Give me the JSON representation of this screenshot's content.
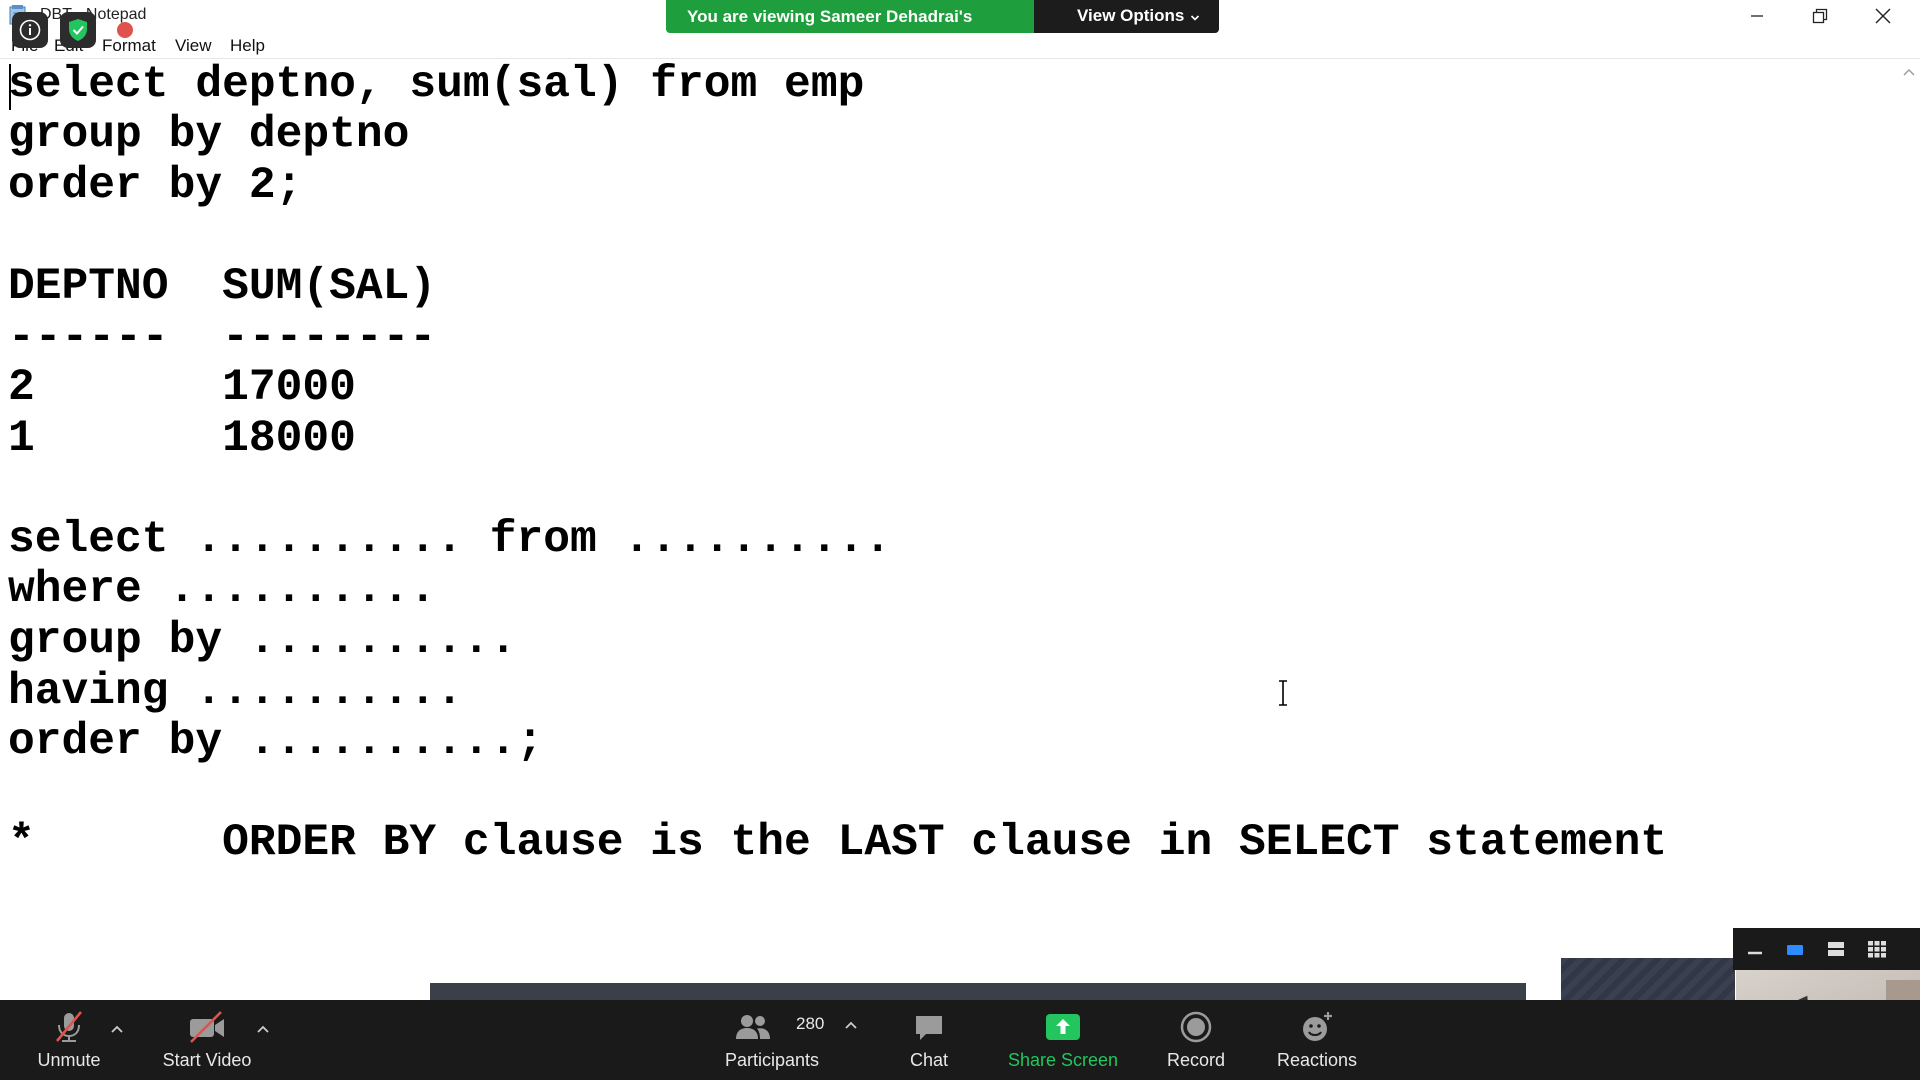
{
  "window": {
    "title": "DBT - Notepad",
    "menu": [
      "File",
      "Edit",
      "Format",
      "View",
      "Help"
    ]
  },
  "zoom_banner": {
    "message": "You are viewing Sameer Dehadrai's screen",
    "view_options": "View Options"
  },
  "editor": {
    "lines": [
      "select deptno, sum(sal) from emp",
      "group by deptno",
      "order by 2;",
      "",
      "DEPTNO  SUM(SAL)",
      "------  --------",
      "2       17000",
      "1       18000",
      "",
      "select .......... from ..........",
      "where ..........",
      "group by ..........",
      "having ..........",
      "order by ..........;",
      "",
      "*       ORDER BY clause is the LAST clause in SELECT statement"
    ]
  },
  "toolbar": {
    "unmute": "Unmute",
    "start_video": "Start Video",
    "participants": "Participants",
    "participants_count": "280",
    "chat": "Chat",
    "share_screen": "Share Screen",
    "record": "Record",
    "reactions": "Reactions"
  },
  "colors": {
    "banner_green": "#1f9e3e",
    "toolbar_bg": "#1a1a1a",
    "share_green": "#23c55e",
    "unmute_red": "#e0524c"
  },
  "icons": [
    "notepad-icon",
    "info-icon",
    "shield-check-icon",
    "recording-dot-icon",
    "minimize-icon",
    "restore-icon",
    "close-icon",
    "mic-muted-icon",
    "video-off-icon",
    "participants-icon",
    "chat-icon",
    "share-screen-icon",
    "record-icon",
    "reactions-icon",
    "i-beam-cursor-icon"
  ]
}
